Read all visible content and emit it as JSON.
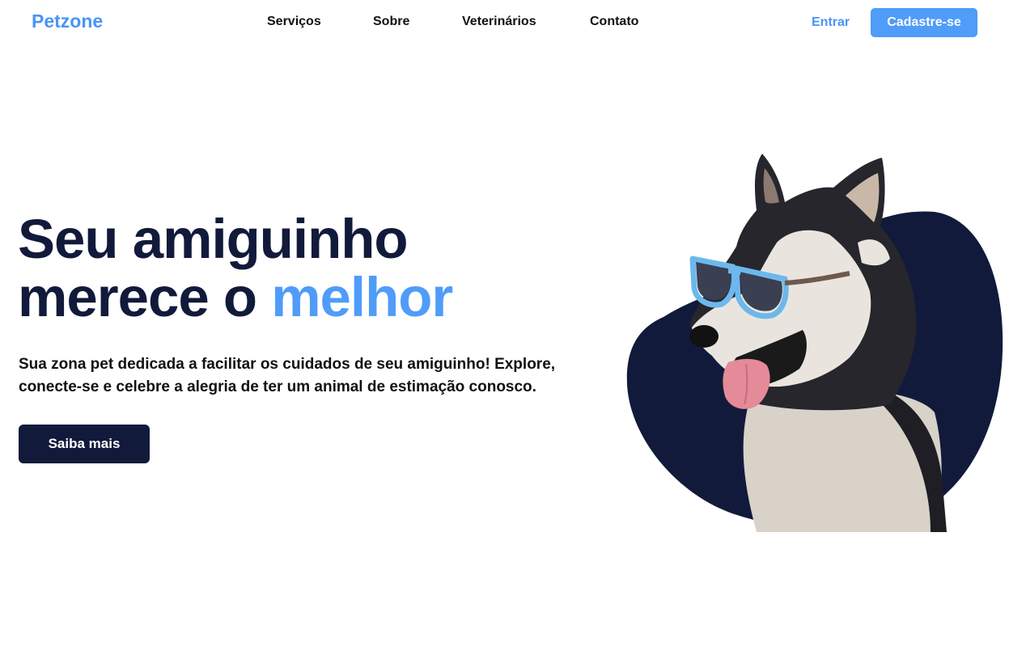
{
  "header": {
    "logo": "Petzone",
    "nav": [
      "Serviços",
      "Sobre",
      "Veterinários",
      "Contato"
    ],
    "login_label": "Entrar",
    "signup_label": "Cadastre-se"
  },
  "hero": {
    "title_line1": "Seu amiguinho",
    "title_line2_prefix": "merece o ",
    "title_line2_accent": "melhor",
    "subtitle_line1": "Sua zona pet dedicada a facilitar os cuidados de seu amiguinho! Explore,",
    "subtitle_line2": "conecte-se e celebre a alegria de ter um animal de estimação conosco.",
    "cta_label": "Saiba mais"
  },
  "illustration": {
    "icon": "husky-with-sunglasses",
    "blob_color": "#121a3b",
    "sunglasses_color": "#6cb8ec"
  },
  "colors": {
    "brand": "#4f9cf9",
    "dark": "#121a3b"
  }
}
